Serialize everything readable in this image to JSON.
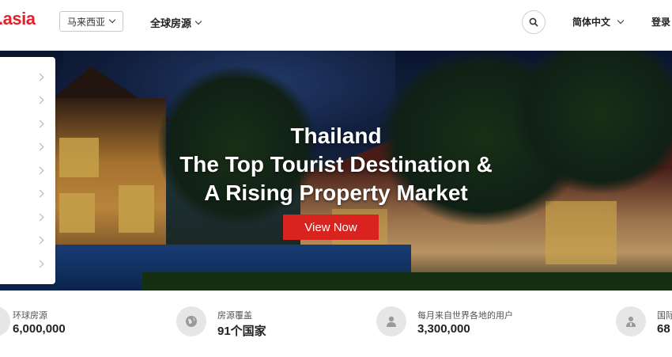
{
  "header": {
    "logo": ".asia",
    "country": "马来西亚",
    "global_nav": "全球房源",
    "language": "简体中文",
    "login": "登录"
  },
  "hero": {
    "line1": "Thailand",
    "line2": "The Top Tourist Destination &",
    "line3": "A Rising Property Market",
    "button": "View Now"
  },
  "side_menu": {
    "items": [
      "",
      "",
      "",
      "",
      "",
      "",
      "",
      "",
      ""
    ]
  },
  "stats": [
    {
      "label": "环球房源",
      "value": "6,000,000",
      "icon": "home-icon"
    },
    {
      "label": "房源覆盖",
      "value": "91个国家",
      "icon": "globe-icon"
    },
    {
      "label": "每月来自世界各地的用户",
      "value": "3,300,000",
      "icon": "user-icon"
    },
    {
      "label": "国际",
      "value": "68",
      "icon": "agent-icon"
    }
  ],
  "colors": {
    "brand": "#e4202a",
    "button": "#d8231f"
  }
}
